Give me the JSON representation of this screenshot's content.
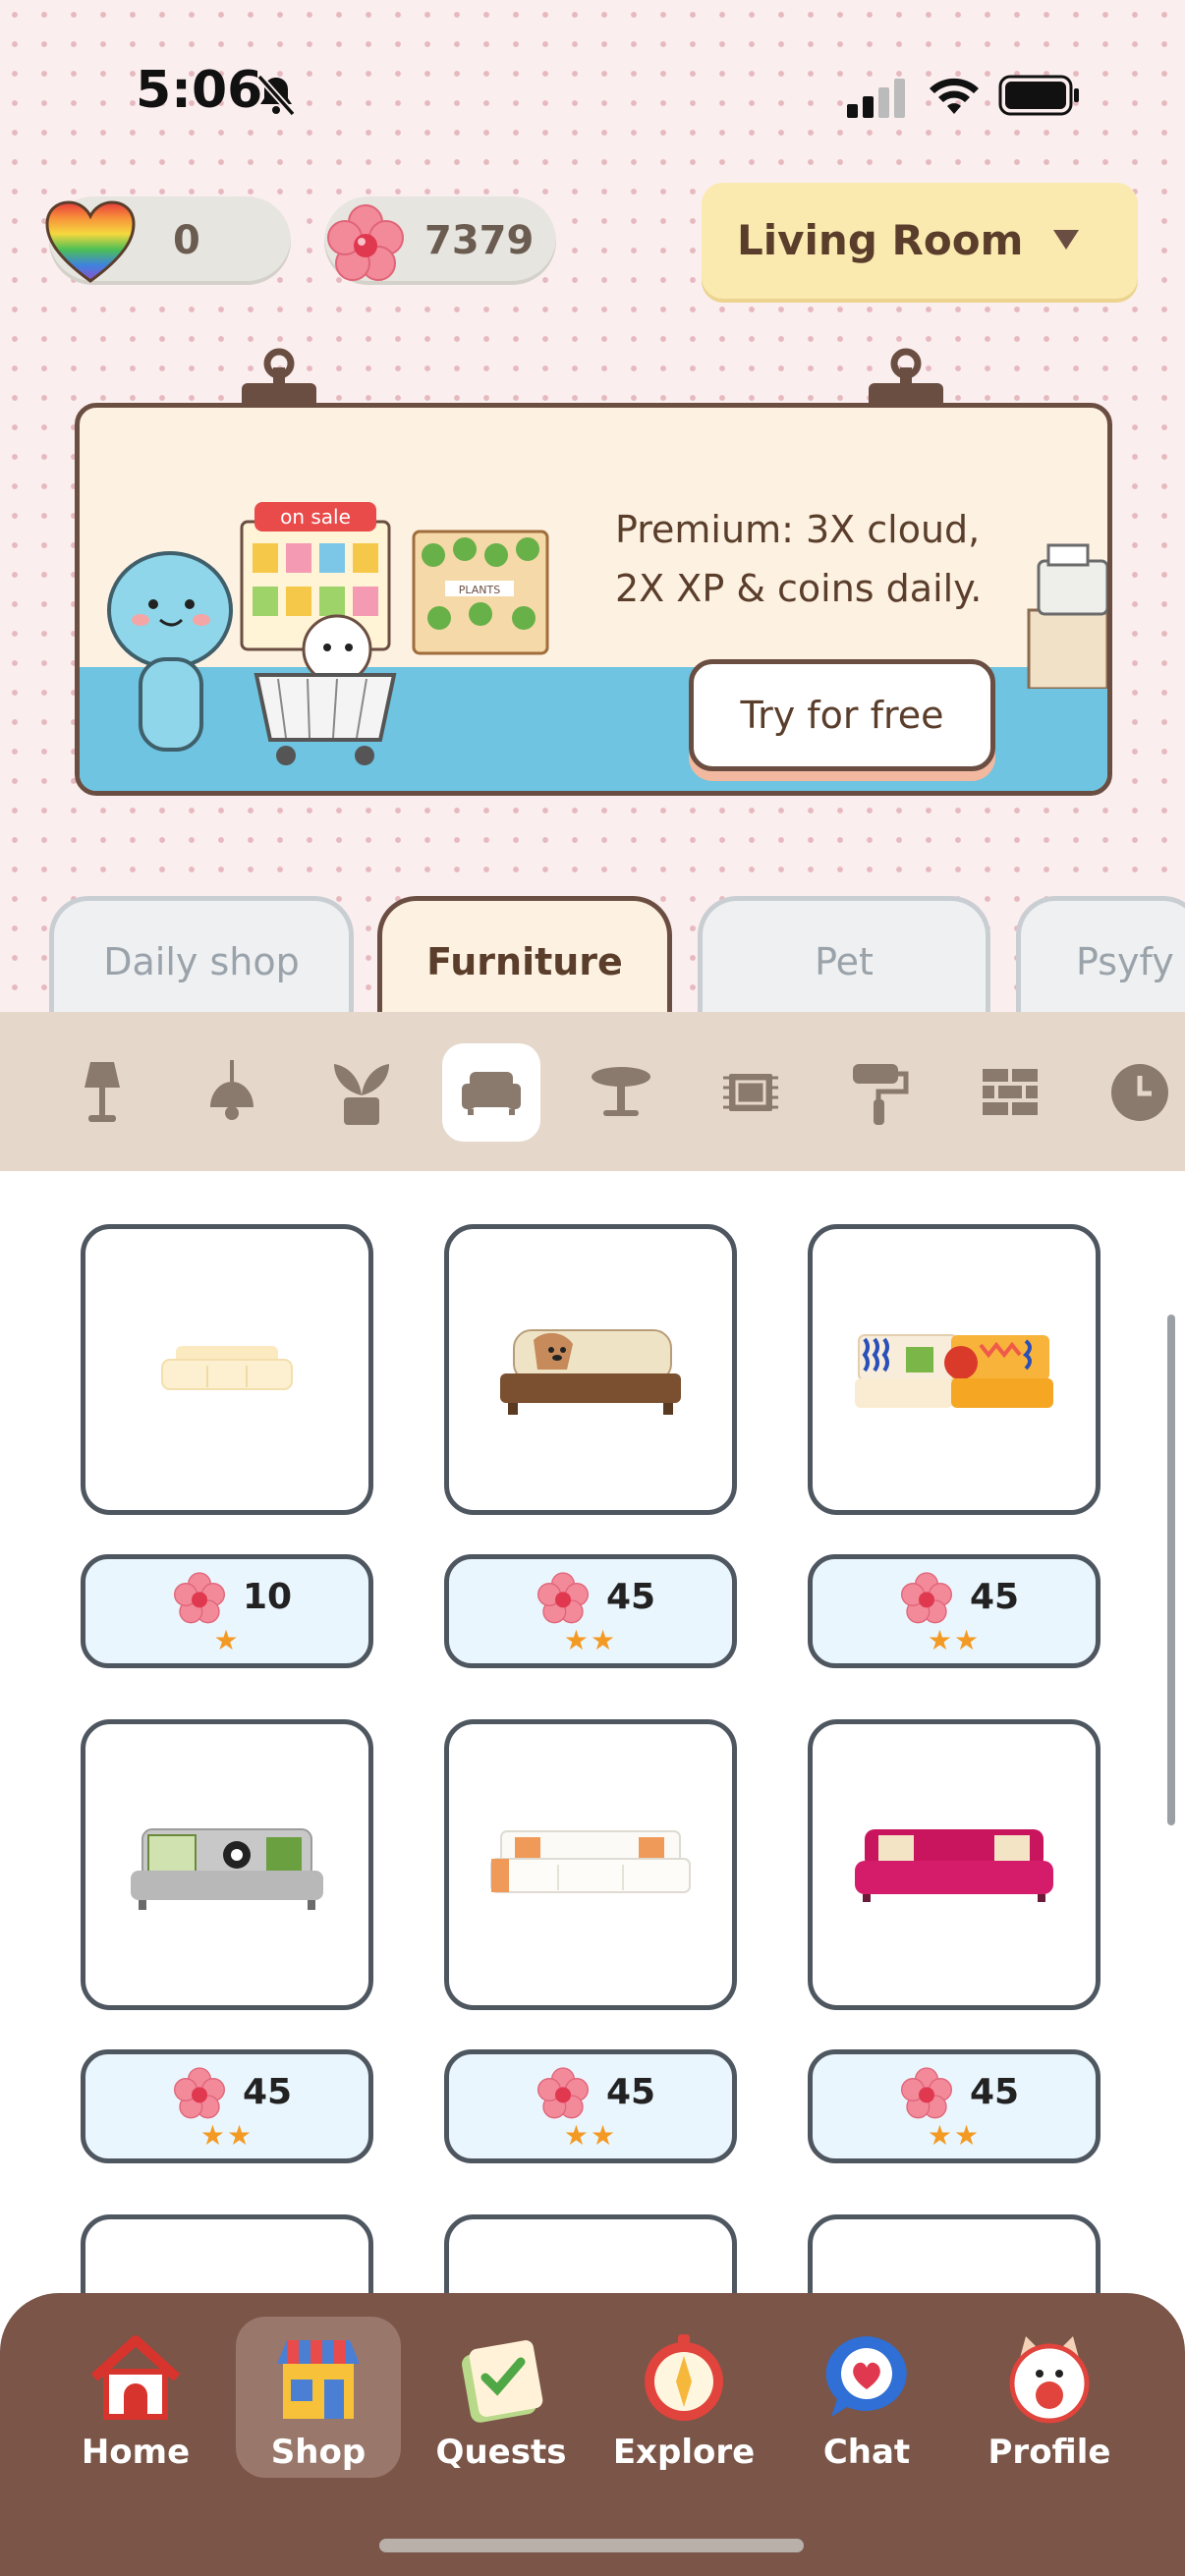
{
  "status_bar": {
    "time": "5:06"
  },
  "currency": {
    "hearts": "0",
    "flowers": "7379"
  },
  "room_selector": {
    "label": "Living Room"
  },
  "banner": {
    "sale_sign": "on sale",
    "plants_sign": "PLANTS",
    "line1": "Premium: 3X cloud,",
    "line2": "2X XP & coins daily.",
    "cta": "Try for free"
  },
  "tabs": [
    {
      "label": "Daily shop",
      "active": false
    },
    {
      "label": "Furniture",
      "active": true
    },
    {
      "label": "Pet",
      "active": false
    },
    {
      "label": "Psyfy",
      "active": false
    }
  ],
  "categories": [
    {
      "icon": "floor-lamp-icon"
    },
    {
      "icon": "ceiling-lamp-icon"
    },
    {
      "icon": "plant-icon"
    },
    {
      "icon": "sofa-icon",
      "active": true
    },
    {
      "icon": "table-icon"
    },
    {
      "icon": "rug-icon"
    },
    {
      "icon": "paint-roller-icon"
    },
    {
      "icon": "brick-wall-icon"
    },
    {
      "icon": "clock-icon"
    }
  ],
  "items": [
    {
      "name": "cream-sofa",
      "price": "10",
      "stars": "★"
    },
    {
      "name": "dog-sofa",
      "price": "45",
      "stars": "★★"
    },
    {
      "name": "patterned-sofa",
      "price": "45",
      "stars": "★★"
    },
    {
      "name": "grey-sofa",
      "price": "45",
      "stars": "★★"
    },
    {
      "name": "white-sofa",
      "price": "45",
      "stars": "★★"
    },
    {
      "name": "magenta-sofa",
      "price": "45",
      "stars": "★★"
    }
  ],
  "nav": [
    {
      "label": "Home",
      "icon": "house-icon"
    },
    {
      "label": "Shop",
      "icon": "shop-icon",
      "active": true
    },
    {
      "label": "Quests",
      "icon": "checklist-icon"
    },
    {
      "label": "Explore",
      "icon": "compass-icon"
    },
    {
      "label": "Chat",
      "icon": "chat-heart-icon"
    },
    {
      "label": "Profile",
      "icon": "cat-avatar-icon"
    }
  ],
  "colors": {
    "accent_brown": "#6b4e42",
    "nav_bg": "#7a5548",
    "price_bg": "#eaf6fd",
    "star": "#f39a24",
    "room_bg": "#faeab0"
  }
}
